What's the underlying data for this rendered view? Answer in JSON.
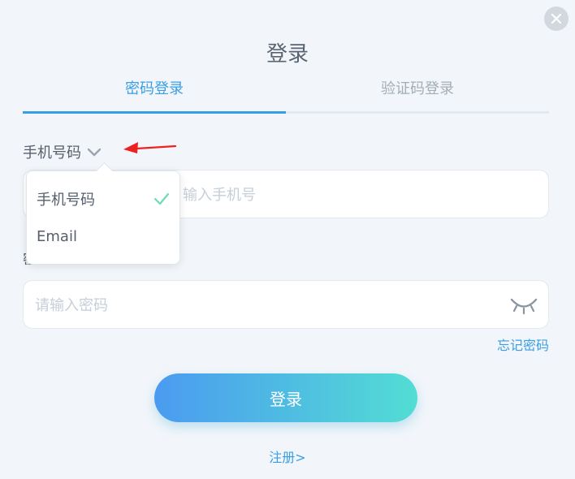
{
  "dialog": {
    "title": "登录",
    "tabs": [
      {
        "label": "密码登录",
        "active": true
      },
      {
        "label": "验证码登录",
        "active": false
      }
    ],
    "account_type": {
      "selected": "手机号码",
      "options": [
        "手机号码",
        "Email"
      ]
    },
    "phone_placeholder": "请输入手机号",
    "phone_placeholder_visible": "输入手机号",
    "password_label": "密码",
    "password_placeholder": "请输入密码",
    "forgot_label": "忘记密码",
    "login_label": "登录",
    "register_label": "注册>"
  },
  "colors": {
    "accent": "#3a9ee4",
    "gradient_start": "#4b9bf0",
    "gradient_end": "#52ddd4",
    "check": "#6fd9b8",
    "annotation_arrow": "#ee2020"
  },
  "icons": [
    "close-icon",
    "chevron-down-icon",
    "eye-closed-icon",
    "check-icon",
    "annotation-arrow-icon"
  ]
}
